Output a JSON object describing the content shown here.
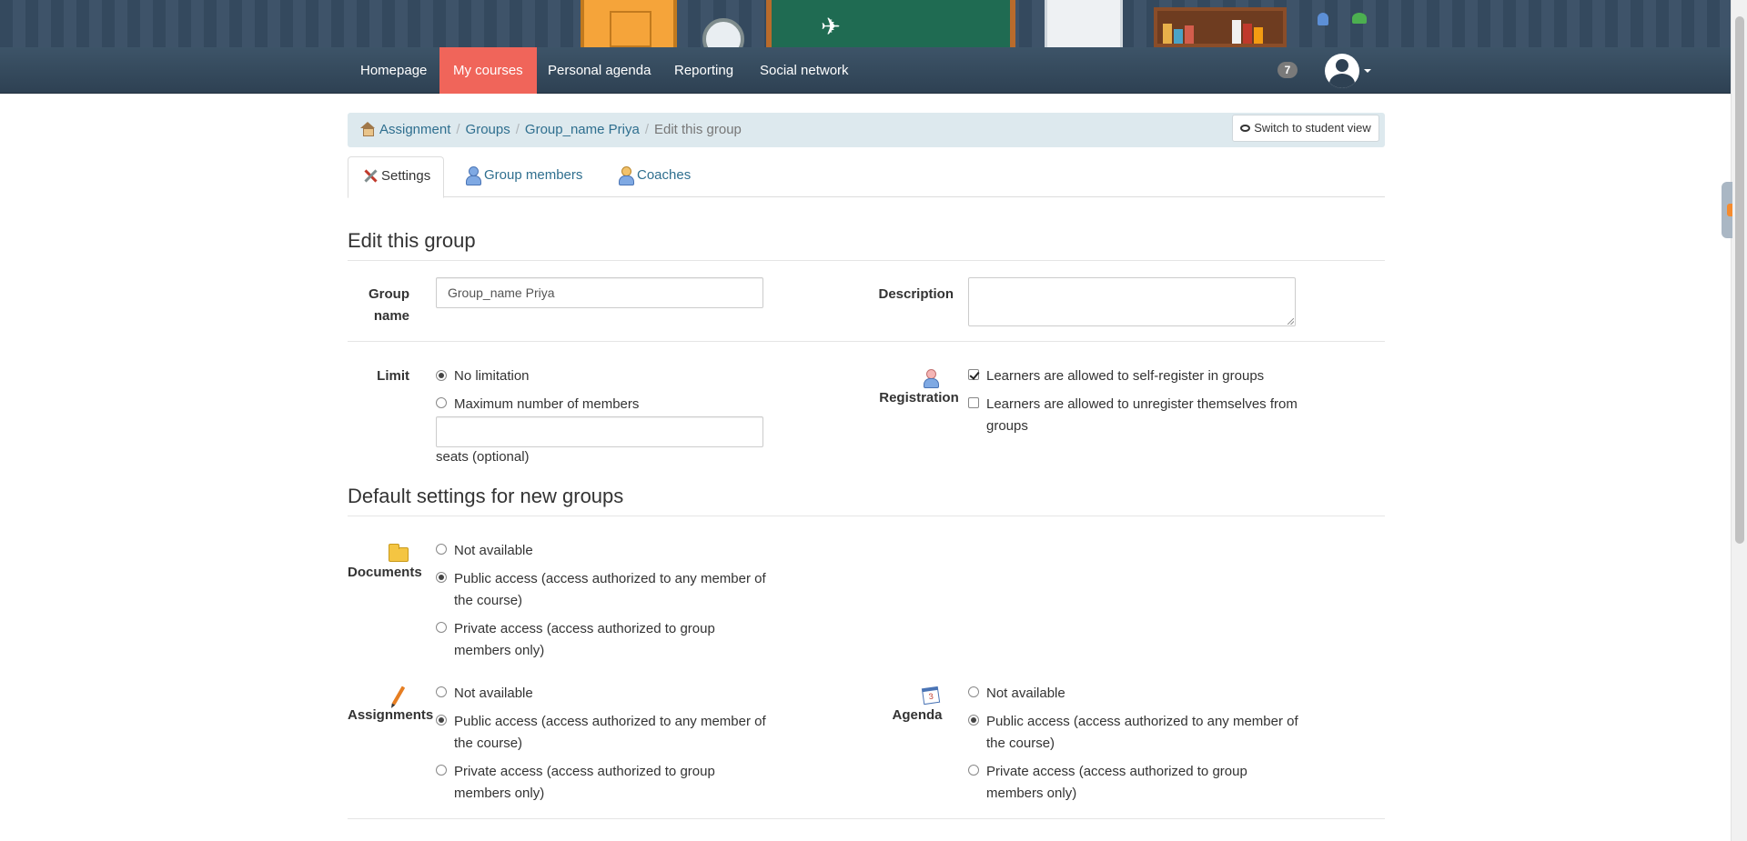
{
  "nav": {
    "items": [
      "Homepage",
      "My courses",
      "Personal agenda",
      "Reporting",
      "Social network"
    ],
    "active": "My courses",
    "notification_count": "7"
  },
  "breadcrumb": {
    "items": [
      "Assignment",
      "Groups",
      "Group_name Priya"
    ],
    "current": "Edit this group"
  },
  "student_view_button": "Switch to student view",
  "tabs": [
    "Settings",
    "Group members",
    "Coaches"
  ],
  "form": {
    "title": "Edit this group",
    "group_name_label_1": "Group",
    "group_name_label_2": "name",
    "group_name_value": "Group_name Priya",
    "description_label": "Description",
    "description_value": "",
    "limit_label": "Limit",
    "limit_options": [
      "No limitation",
      "Maximum number of members"
    ],
    "limit_selected": 0,
    "max_members_value": "",
    "seats_hint": "seats (optional)",
    "registration_label": "Registration",
    "registration_options": [
      {
        "line1": "Learners are allowed to self-register in groups",
        "line2": "",
        "checked": true
      },
      {
        "line1": "Learners are allowed to unregister themselves from",
        "line2": "groups",
        "checked": false
      }
    ]
  },
  "defaults": {
    "title": "Default settings for new groups",
    "documents": {
      "label": "Documents",
      "options": [
        {
          "line1": "Not available",
          "line2": ""
        },
        {
          "line1": "Public access (access authorized to any member of",
          "line2": "the course)"
        },
        {
          "line1": "Private access (access authorized to group",
          "line2": "members only)"
        }
      ],
      "selected": 1
    },
    "assignments": {
      "label": "Assignments",
      "options": [
        {
          "line1": "Not available",
          "line2": ""
        },
        {
          "line1": "Public access (access authorized to any member of",
          "line2": "the course)"
        },
        {
          "line1": "Private access (access authorized to group",
          "line2": "members only)"
        }
      ],
      "selected": 1
    },
    "agenda": {
      "label": "Agenda",
      "options": [
        {
          "line1": "Not available",
          "line2": ""
        },
        {
          "line1": "Public access (access authorized to any member of",
          "line2": "the course)"
        },
        {
          "line1": "Private access (access authorized to group",
          "line2": "members only)"
        }
      ],
      "selected": 1
    }
  },
  "colors": {
    "navbar": "#34495e",
    "active_nav": "#f0655a",
    "link": "#2f6f8f",
    "breadcrumb_bg": "#dde9ee"
  }
}
